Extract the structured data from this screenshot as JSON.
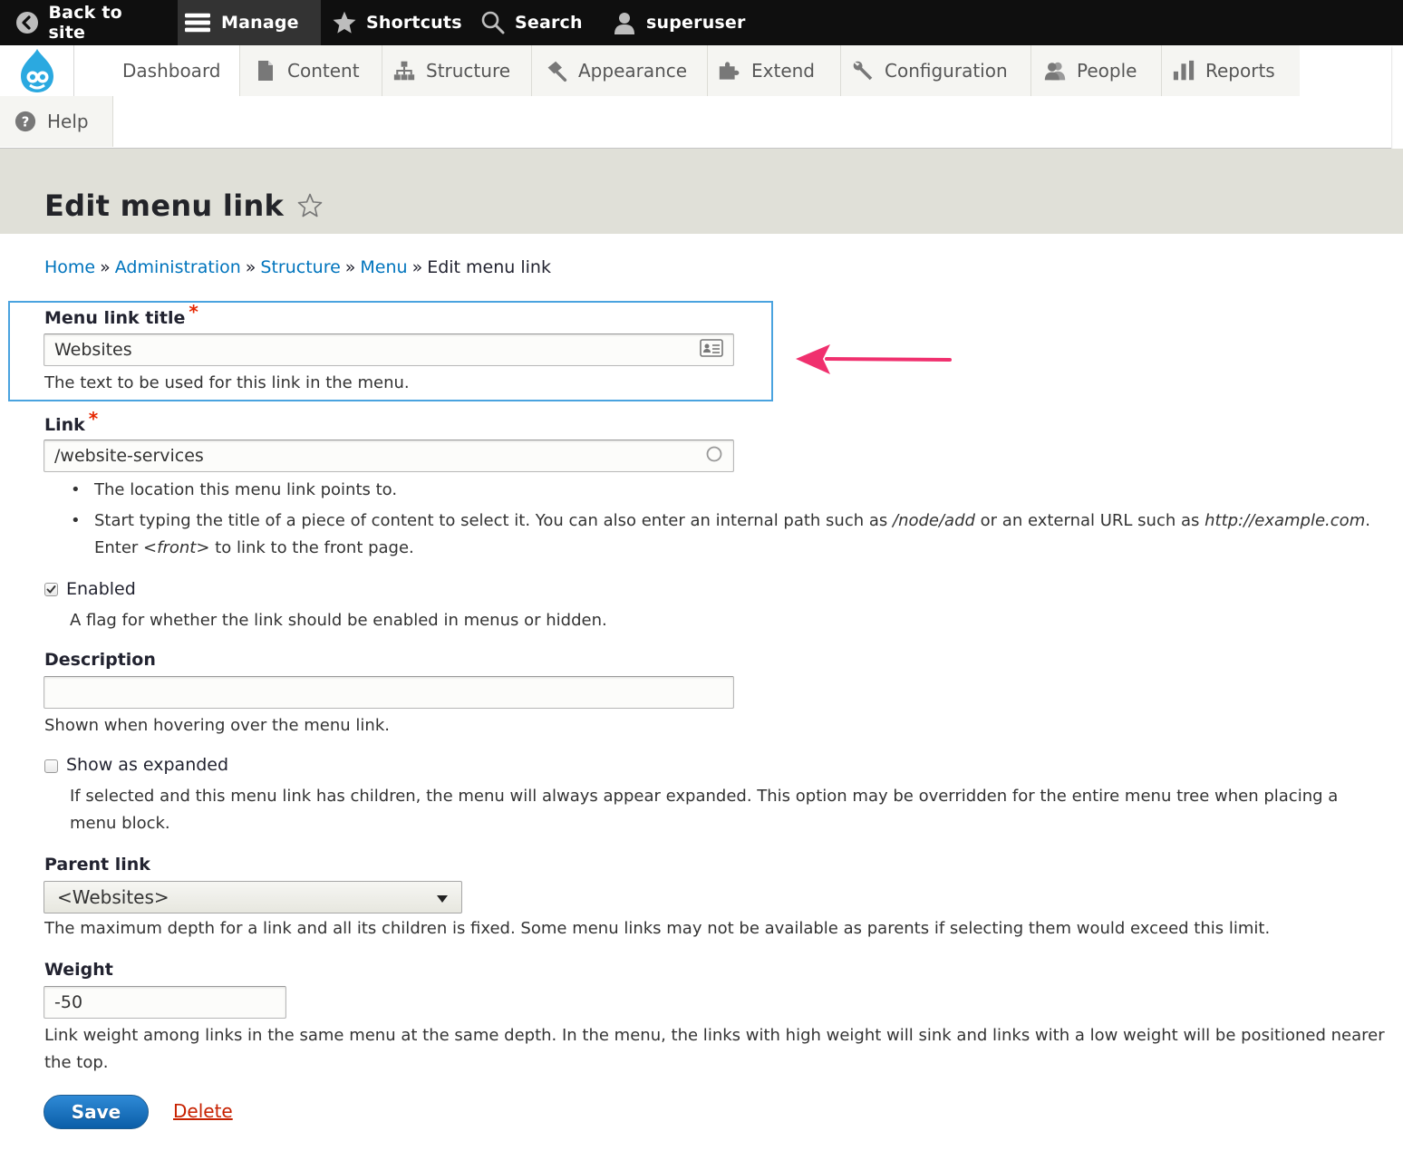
{
  "toolbar": {
    "back_label": "Back to site",
    "manage_label": "Manage",
    "shortcuts_label": "Shortcuts",
    "search_label": "Search",
    "user_label": "superuser"
  },
  "admin_menu": {
    "dashboard": "Dashboard",
    "content": "Content",
    "structure": "Structure",
    "appearance": "Appearance",
    "extend": "Extend",
    "configuration": "Configuration",
    "people": "People",
    "reports": "Reports",
    "help": "Help"
  },
  "page": {
    "title": "Edit menu link"
  },
  "breadcrumb": {
    "home": "Home",
    "administration": "Administration",
    "structure": "Structure",
    "menu": "Menu",
    "current": "Edit menu link",
    "separator": "»"
  },
  "form": {
    "title_field": {
      "label": "Menu link title",
      "required_mark": "*",
      "value": "Websites",
      "description": "The text to be used for this link in the menu."
    },
    "link_field": {
      "label": "Link",
      "required_mark": "*",
      "value": "/website-services",
      "help_1": "The location this menu link points to.",
      "help_2a": "Start typing the title of a piece of content to select it. You can also enter an internal path such as ",
      "help_2_path": "/node/add",
      "help_2b": " or an external URL such as ",
      "help_2_url": "http://example.com",
      "help_2c": ". Enter ",
      "help_2_front": "<front>",
      "help_2d": " to link to the front page."
    },
    "enabled": {
      "label": "Enabled",
      "checked": true,
      "description": "A flag for whether the link should be enabled in menus or hidden."
    },
    "description_field": {
      "label": "Description",
      "value": "",
      "help": "Shown when hovering over the menu link."
    },
    "expanded": {
      "label": "Show as expanded",
      "checked": false,
      "description": "If selected and this menu link has children, the menu will always appear expanded. This option may be overridden for the entire menu tree when placing a menu block."
    },
    "parent": {
      "label": "Parent link",
      "selected": "<Websites>",
      "description": "The maximum depth for a link and all its children is fixed. Some menu links may not be available as parents if selecting them would exceed this limit."
    },
    "weight": {
      "label": "Weight",
      "value": "-50",
      "description": "Link weight among links in the same menu at the same depth. In the menu, the links with high weight will sink and links with a low weight will be positioned nearer the top."
    },
    "save_label": "Save",
    "delete_label": "Delete"
  },
  "colors": {
    "toolbar_bg": "#0f0f0f",
    "link": "#0074bd",
    "required": "#e62600",
    "delete": "#c72100",
    "save_button": "#0b5ea8",
    "highlight_border": "#4aa3df",
    "annotation_arrow": "#f0306e"
  }
}
